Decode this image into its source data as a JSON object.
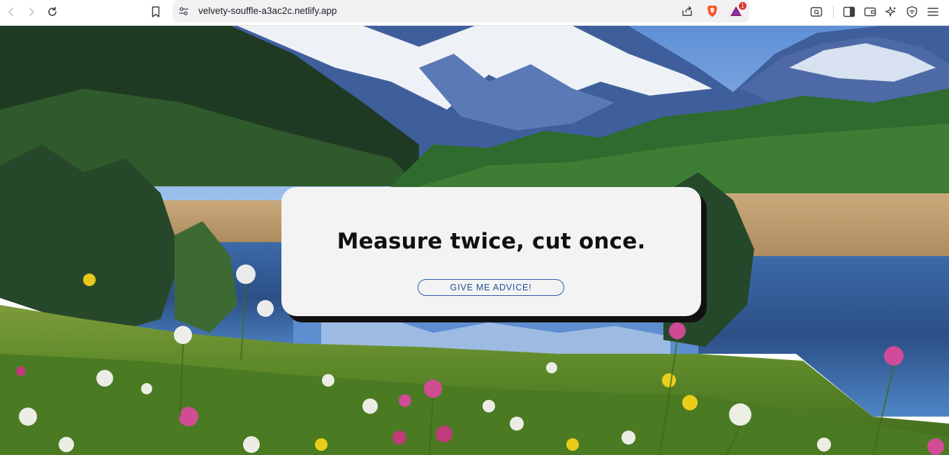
{
  "browser": {
    "url": "velvety-souffle-a3ac2c.netlify.app",
    "notification_count": "1",
    "icons": [
      "back-icon",
      "forward-icon",
      "reload-icon",
      "bookmark-icon",
      "site-settings-icon",
      "share-icon",
      "brave-shields-icon",
      "brave-rewards-icon",
      "search-tabs-icon",
      "sidebar-icon",
      "wallet-icon",
      "leo-ai-icon",
      "vpn-icon",
      "menu-icon"
    ]
  },
  "card": {
    "quote": "Measure twice, cut once.",
    "button_label": "GIVE ME ADVICE!"
  },
  "colors": {
    "card_background": "#f3f3f4",
    "card_shadow": "#111111",
    "button_border": "#2a5aa8",
    "button_text": "#1f4b94",
    "quote_text": "#111111"
  }
}
